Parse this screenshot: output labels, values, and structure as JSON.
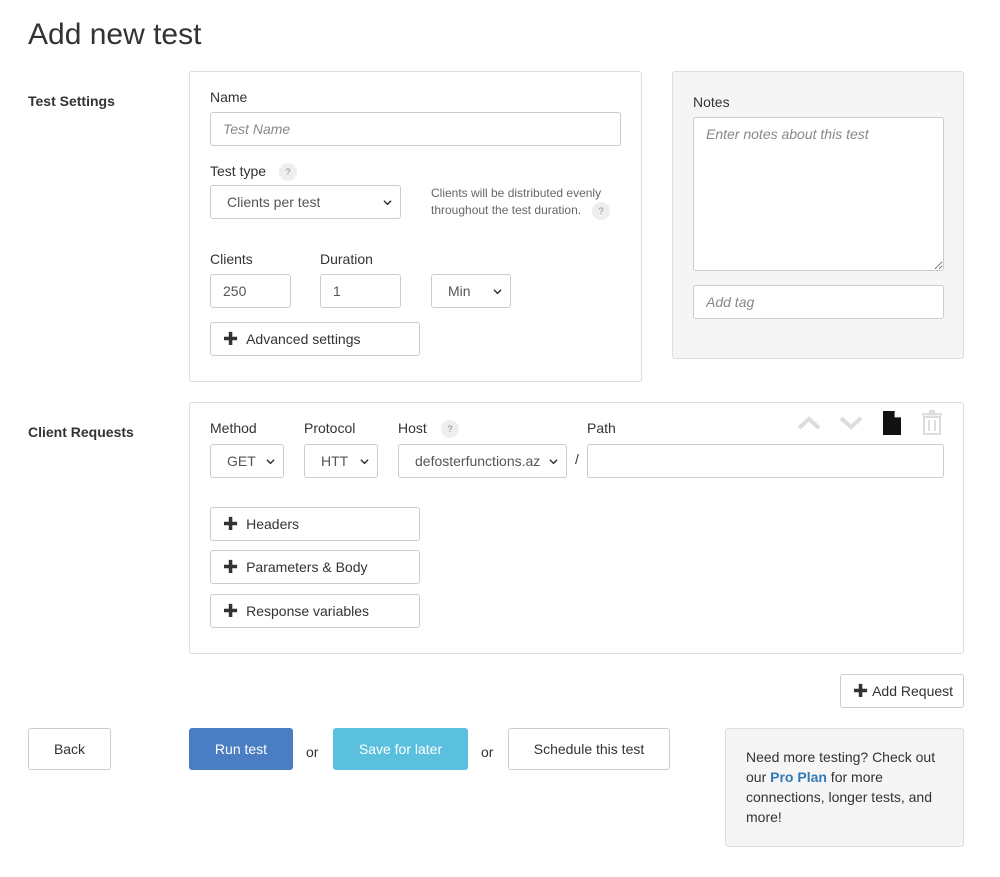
{
  "page": {
    "title": "Add new test"
  },
  "test_settings": {
    "section_label": "Test Settings",
    "name_label": "Name",
    "name_placeholder": "Test Name",
    "name_value": "",
    "test_type_label": "Test type",
    "help_glyph": "?",
    "test_type_value": "Clients per test",
    "test_type_hint": "Clients will be distributed evenly throughout the test duration.",
    "clients_label": "Clients",
    "clients_value": "250",
    "duration_label": "Duration",
    "duration_value": "1",
    "duration_unit": "Min",
    "advanced_label": "Advanced settings"
  },
  "notes": {
    "label": "Notes",
    "placeholder": "Enter notes about this test",
    "tag_placeholder": "Add tag"
  },
  "client_requests": {
    "section_label": "Client Requests",
    "method_label": "Method",
    "method_value": "GET",
    "protocol_label": "Protocol",
    "protocol_value": "HTT",
    "host_label": "Host",
    "host_value": "defosterfunctions.az",
    "path_separator": "/",
    "path_label": "Path",
    "path_value": "",
    "headers_label": "Headers",
    "params_label": "Parameters & Body",
    "response_vars_label": "Response variables",
    "icons": [
      "chevron-up-icon",
      "chevron-down-icon",
      "copy-icon",
      "trash-icon"
    ]
  },
  "actions": {
    "add_request_label": "Add Request",
    "back_label": "Back",
    "run_label": "Run test",
    "or_1": "or",
    "save_label": "Save for later",
    "or_2": "or",
    "schedule_label": "Schedule this test"
  },
  "promo": {
    "before": "Need more testing? Check out our ",
    "link": "Pro Plan",
    "after": " for more connections, longer tests, and more!"
  },
  "colors": {
    "primary": "#4a7dc2",
    "info": "#5bc0de",
    "link": "#337ab7",
    "border": "#dddddd",
    "panel_grey": "#f5f5f5"
  }
}
